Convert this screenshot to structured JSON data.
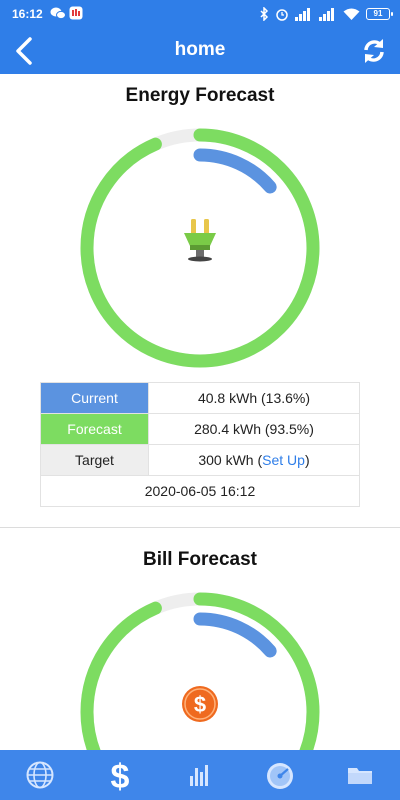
{
  "status_bar": {
    "time": "16:12",
    "battery": "91"
  },
  "header": {
    "title": "home",
    "back_icon": "chevron-left-icon",
    "refresh_icon": "refresh-icon"
  },
  "energy": {
    "title": "Energy Forecast",
    "icon": "power-plug-icon",
    "current_fraction": 0.136,
    "forecast_fraction": 0.935,
    "colors": {
      "current": "#5b93e0",
      "forecast": "#7ddc61",
      "track": "#eeeeee"
    },
    "rows": {
      "current_label": "Current",
      "current_value": "40.8 kWh (13.6%)",
      "forecast_label": "Forecast",
      "forecast_value": "280.4 kWh (93.5%)",
      "target_label": "Target",
      "target_value": "300 kWh (",
      "setup_link": "Set Up",
      "target_close": ")",
      "timestamp": "2020-06-05 16:12"
    }
  },
  "bill": {
    "title": "Bill Forecast",
    "icon": "dollar-coin-icon"
  },
  "bottom_nav": [
    {
      "name": "globe-icon"
    },
    {
      "name": "dollar-icon"
    },
    {
      "name": "bar-chart-icon"
    },
    {
      "name": "gauge-icon"
    },
    {
      "name": "folder-icon"
    }
  ]
}
